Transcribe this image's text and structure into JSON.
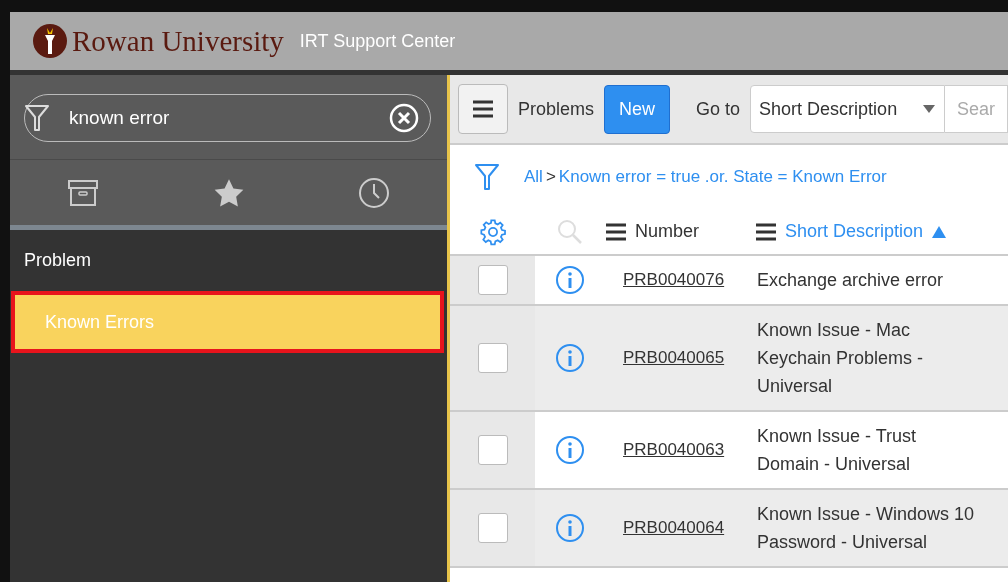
{
  "header": {
    "logo_text": "Rowan University",
    "title": "IRT Support Center"
  },
  "sidebar": {
    "filter": {
      "value": "known error"
    },
    "tabs": [
      {
        "kind": "archive",
        "selected": false
      },
      {
        "kind": "star",
        "selected": false
      },
      {
        "kind": "history",
        "selected": false
      }
    ],
    "items": [
      {
        "label": "Problem",
        "kind": "heading",
        "selected": false
      },
      {
        "label": "Known Errors",
        "kind": "module",
        "selected": true
      }
    ]
  },
  "toolbar": {
    "list_title": "Problems",
    "new_button": "New",
    "goto_label": "Go to",
    "goto_field": "Short Description",
    "search": {
      "placeholder": "Sear"
    }
  },
  "breadcrumb": [
    {
      "label": "All"
    },
    {
      "separator": ">",
      "label": "Known error = true .or. State = Known Error"
    }
  ],
  "table": {
    "columns": [
      {
        "label": "Number",
        "sorted": false
      },
      {
        "label": "Short Description",
        "sorted": true
      }
    ],
    "rows": [
      {
        "checked": false,
        "number": "PRB0040076",
        "description": "Exchange archive error"
      },
      {
        "checked": false,
        "number": "PRB0040065",
        "description": "Known Issue - Mac Keychain Problems - Universal"
      },
      {
        "checked": false,
        "number": "PRB0040063",
        "description": "Known Issue - Trust Domain - Universal"
      },
      {
        "checked": false,
        "number": "PRB0040064",
        "description": "Known Issue - Windows 10 Password - Universal"
      }
    ]
  }
}
